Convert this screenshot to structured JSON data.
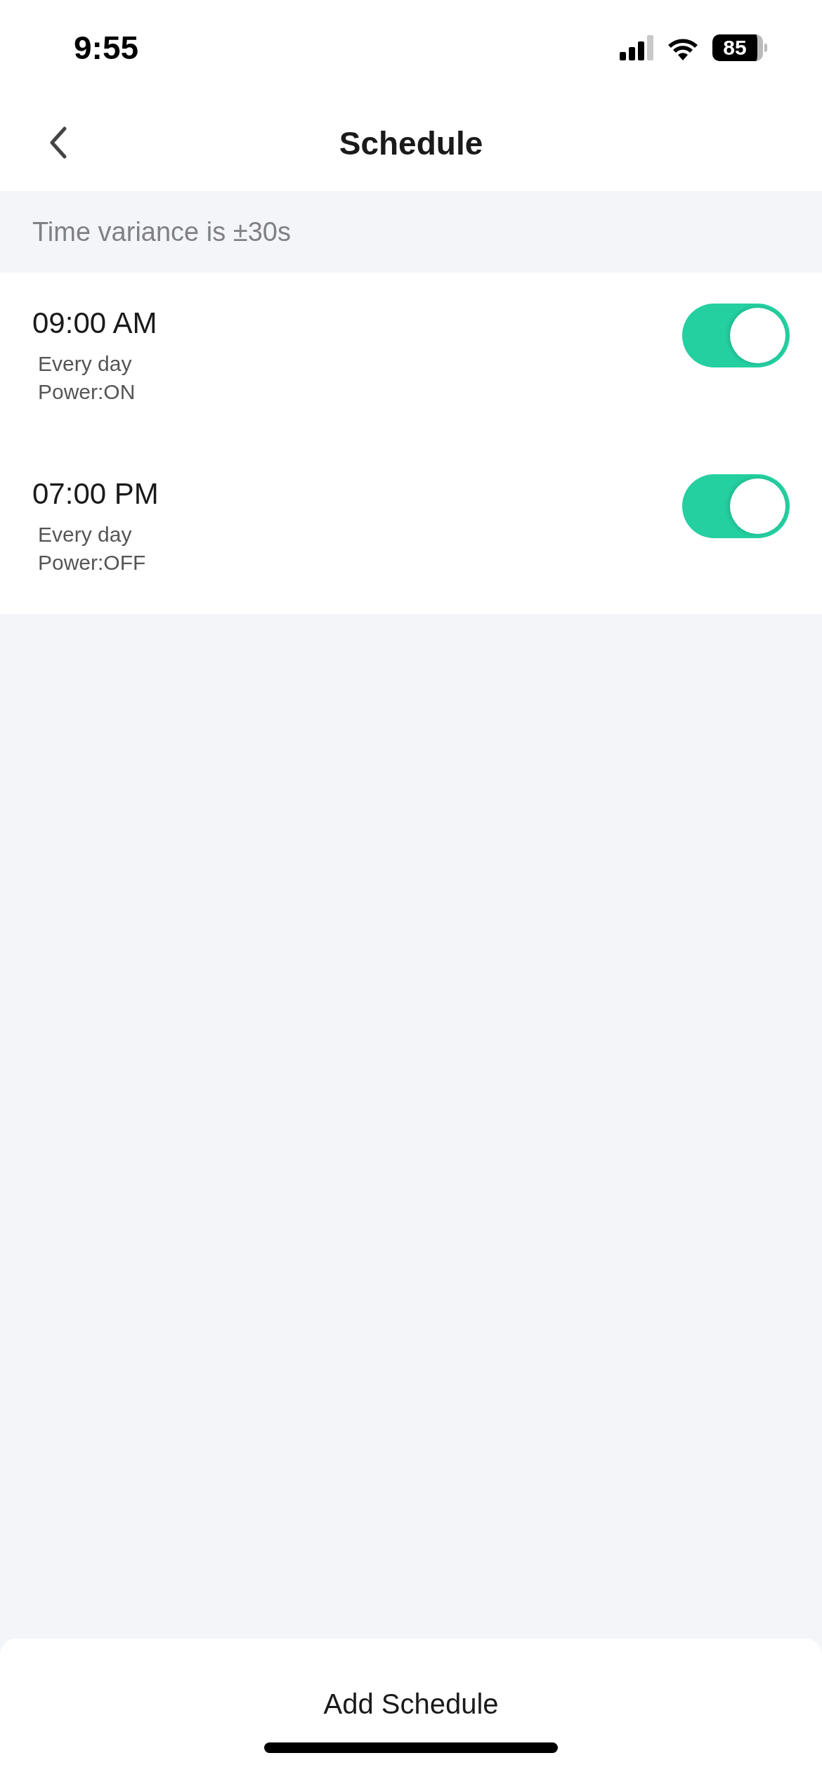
{
  "status_bar": {
    "time": "9:55",
    "battery": "85"
  },
  "nav": {
    "title": "Schedule"
  },
  "notice": "Time variance is  ±30s",
  "schedules": [
    {
      "time": "09:00 AM",
      "repeat": "Every day",
      "action": "Power:ON",
      "on": true
    },
    {
      "time": "07:00 PM",
      "repeat": "Every day",
      "action": "Power:OFF",
      "on": true
    }
  ],
  "add_button": "Add Schedule"
}
